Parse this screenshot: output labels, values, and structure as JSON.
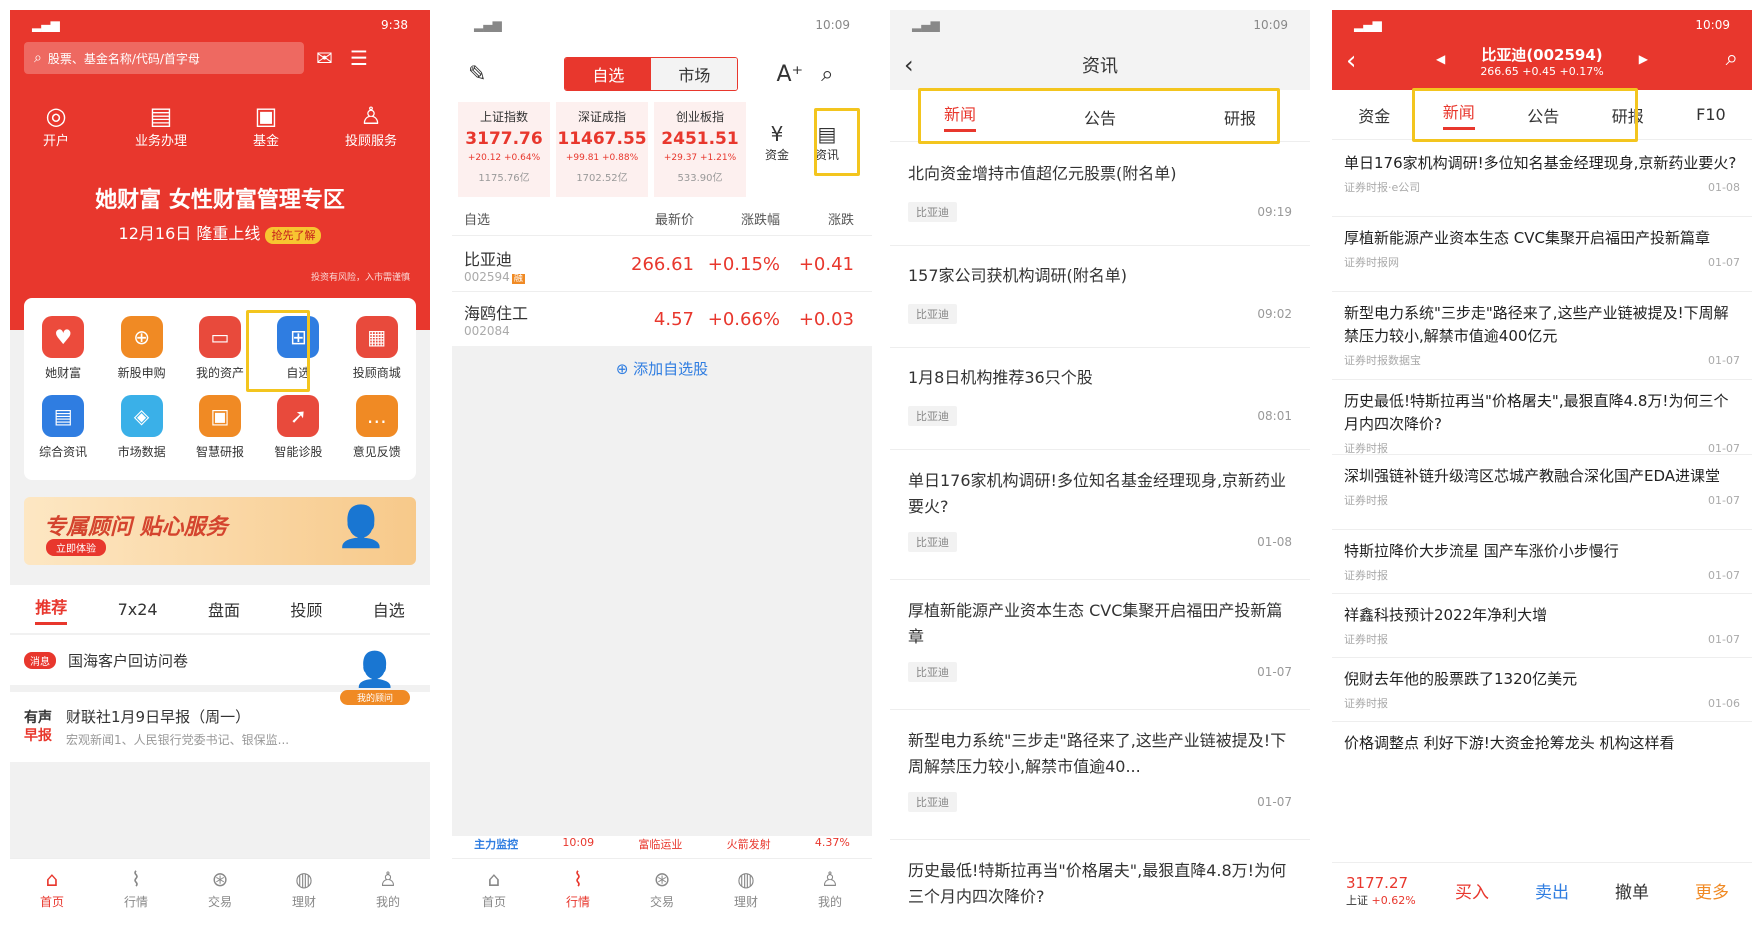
{
  "p1": {
    "status_time": "9:38",
    "search_placeholder": "股票、基金名称/代码/首字母",
    "quick": [
      "开户",
      "业务办理",
      "基金",
      "投顾服务"
    ],
    "banner_title": "她财富 女性财富管理专区",
    "banner_date": "12月16日 隆重上线",
    "banner_btn": "抢先了解",
    "banner_risk": "投资有风险，入市需谨慎",
    "grid1": [
      "她财富",
      "新股申购",
      "我的资产",
      "自选",
      "投顾商城"
    ],
    "grid2": [
      "综合资讯",
      "市场数据",
      "智慧研报",
      "智能诊股",
      "意见反馈"
    ],
    "ad_title": "专属顾问 贴心服务",
    "ad_btn": "立即体验",
    "tabs": [
      "推荐",
      "7x24",
      "盘面",
      "投顾",
      "自选"
    ],
    "notice_badge": "消息",
    "notice": "国海客户回访问卷",
    "news_logo_1": "有声",
    "news_logo_2": "早报",
    "news_title": "财联社1月9日早报（周一）",
    "news_sub": "宏观新闻1、人民银行党委书记、银保监...",
    "advisor": "我的顾问",
    "tabbar": [
      "首页",
      "行情",
      "交易",
      "理财",
      "我的"
    ]
  },
  "p2": {
    "status_time": "10:09",
    "seg": [
      "自选",
      "市场"
    ],
    "indices": [
      {
        "name": "上证指数",
        "value": "3177.76",
        "chg": "+20.12 +0.64%",
        "amt": "1175.76亿"
      },
      {
        "name": "深证成指",
        "value": "11467.55",
        "chg": "+99.81 +0.88%",
        "amt": "1702.52亿"
      },
      {
        "name": "创业板指",
        "value": "2451.51",
        "chg": "+29.37 +1.21%",
        "amt": "533.90亿"
      }
    ],
    "fund": "资金",
    "info": "资讯",
    "cols": [
      "自选",
      "最新价",
      "涨跌幅",
      "涨跌"
    ],
    "stocks": [
      {
        "name": "比亚迪",
        "code": "002594",
        "badge": "融",
        "price": "266.61",
        "pct": "+0.15%",
        "chg": "+0.41"
      },
      {
        "name": "海鸥住工",
        "code": "002084",
        "badge": "",
        "price": "4.57",
        "pct": "+0.66%",
        "chg": "+0.03"
      }
    ],
    "add": "添加自选股",
    "ticker": [
      "主力监控",
      "10:09",
      "富临运业",
      "火箭发射",
      "4.37%"
    ],
    "tabbar": [
      "首页",
      "行情",
      "交易",
      "理财",
      "我的"
    ]
  },
  "p3": {
    "status_time": "10:09",
    "title": "资讯",
    "tabs": [
      "新闻",
      "公告",
      "研报"
    ],
    "news": [
      {
        "title": "北向资金增持市值超亿元股票(附名单)",
        "tag": "比亚迪",
        "time": "09:19"
      },
      {
        "title": "157家公司获机构调研(附名单)",
        "tag": "比亚迪",
        "time": "09:02"
      },
      {
        "title": "1月8日机构推荐36只个股",
        "tag": "比亚迪",
        "time": "08:01"
      },
      {
        "title": "单日176家机构调研!多位知名基金经理现身,京新药业要火?",
        "tag": "比亚迪",
        "time": "01-08"
      },
      {
        "title": "厚植新能源产业资本生态 CVC集聚开启福田产投新篇章",
        "tag": "比亚迪",
        "time": "01-07"
      },
      {
        "title": "新型电力系统\"三步走\"路径来了,这些产业链被提及!下周解禁压力较小,解禁市值逾40...",
        "tag": "比亚迪",
        "time": "01-07"
      },
      {
        "title": "历史最低!特斯拉再当\"价格屠夫\",最狠直降4.8万!为何三个月内四次降价?",
        "tag": "",
        "time": ""
      }
    ]
  },
  "p4": {
    "status_time": "10:09",
    "stock_name": "比亚迪(002594)",
    "stock_quote": "266.65 +0.45 +0.17%",
    "tabs": [
      "资金",
      "新闻",
      "公告",
      "研报",
      "F10"
    ],
    "news": [
      {
        "title": "单日176家机构调研!多位知名基金经理现身,京新药业要火?",
        "src": "证券时报·e公司",
        "time": "01-08"
      },
      {
        "title": "厚植新能源产业资本生态 CVC集聚开启福田产投新篇章",
        "src": "证券时报网",
        "time": "01-07"
      },
      {
        "title": "新型电力系统\"三步走\"路径来了,这些产业链被提及!下周解禁压力较小,解禁市值逾400亿元",
        "src": "证券时报数据宝",
        "time": "01-07"
      },
      {
        "title": "历史最低!特斯拉再当\"价格屠夫\",最狠直降4.8万!为何三个月内四次降价?",
        "src": "证券时报",
        "time": "01-07"
      },
      {
        "title": "深圳强链补链升级湾区芯城产教融合深化国产EDA进课堂",
        "src": "证券时报",
        "time": "01-07"
      },
      {
        "title": "特斯拉降价大步流星 国产车涨价小步慢行",
        "src": "证券时报",
        "time": "01-07"
      },
      {
        "title": "祥鑫科技预计2022年净利大增",
        "src": "证券时报",
        "time": "01-07"
      },
      {
        "title": "倪财去年他的股票跌了1320亿美元",
        "src": "证券时报",
        "time": "01-06"
      },
      {
        "title": "价格调整点 利好下游!大资金抢筹龙头 机构这样看",
        "src": "",
        "time": ""
      }
    ],
    "index_val": "3177.27",
    "index_label": "上证",
    "index_pct": "+0.62%",
    "actions": [
      "买入",
      "卖出",
      "撤单",
      "更多"
    ]
  }
}
